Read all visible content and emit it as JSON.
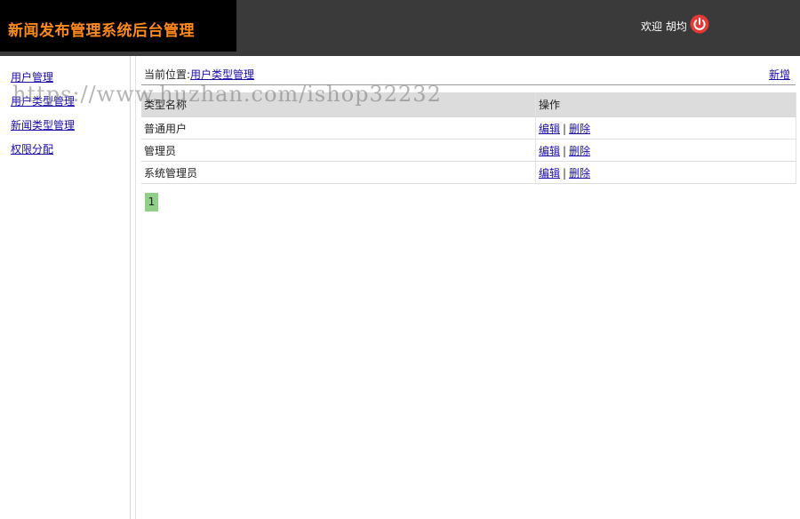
{
  "header": {
    "title": "新闻发布管理系统后台管理",
    "welcome_text": "欢迎 胡均",
    "power_icon": "power-icon",
    "colors": {
      "bar": "#3a3a3a",
      "logo_bg": "#000000",
      "title": "#ff8a1c",
      "power": "#e53935"
    }
  },
  "sidebar": {
    "items": [
      {
        "label": "用户管理"
      },
      {
        "label": "用户类型管理"
      },
      {
        "label": "新闻类型管理"
      },
      {
        "label": "权限分配"
      }
    ]
  },
  "main": {
    "location_prefix": "当前位置:",
    "location_link": "用户类型管理",
    "add_label": "新增",
    "table": {
      "headers": [
        "类型名称",
        "操作"
      ],
      "rows": [
        {
          "name": "普通用户",
          "edit": "编辑",
          "sep": "|",
          "delete": "删除"
        },
        {
          "name": "管理员",
          "edit": "编辑",
          "sep": "|",
          "delete": "删除"
        },
        {
          "name": "系统管理员",
          "edit": "编辑",
          "sep": "|",
          "delete": "删除"
        }
      ]
    },
    "pagination": {
      "current_page": "1",
      "color": "#8fcf87"
    }
  },
  "watermark": "https://www.huzhan.com/ishop32232"
}
